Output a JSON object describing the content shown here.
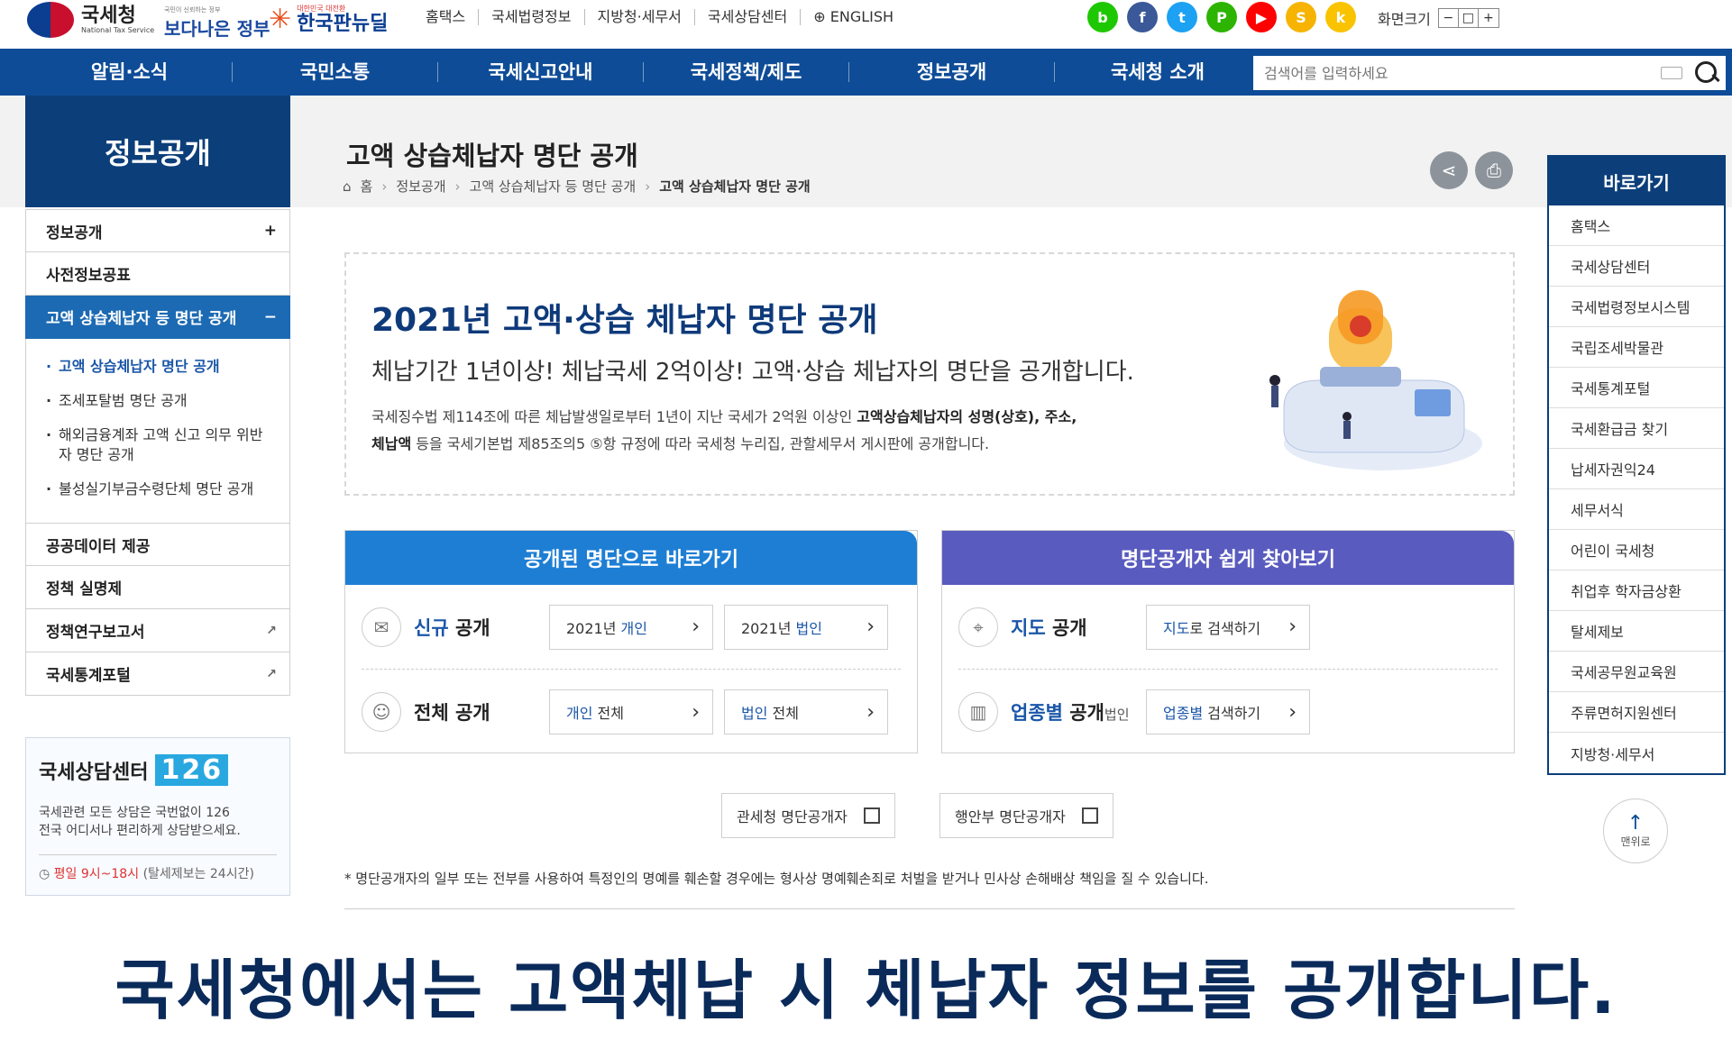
{
  "header": {
    "logo_text": "국세청",
    "logo_sub": "National Tax Service",
    "gov_tag": "국민이 신뢰하는 정부",
    "gov_slogan": "보다나은 정부",
    "newdeal_small": "대한민국 대전환",
    "newdeal_text": "한국판뉴딜",
    "links": [
      "홈택스",
      "국세법령정보",
      "지방청·세무서",
      "국세상담센터",
      "ENGLISH"
    ],
    "zoom_label": "화면크기",
    "zoom_controls": [
      "−",
      "□",
      "+"
    ],
    "sns": [
      {
        "name": "blog-icon",
        "color": "#1ec800",
        "glyph": "b"
      },
      {
        "name": "facebook-icon",
        "color": "#3b5998",
        "glyph": "f"
      },
      {
        "name": "twitter-icon",
        "color": "#1da1f2",
        "glyph": "t"
      },
      {
        "name": "naver-post-icon",
        "color": "#2db400",
        "glyph": "P"
      },
      {
        "name": "youtube-icon",
        "color": "#ff0000",
        "glyph": "▶"
      },
      {
        "name": "kakaostory-icon",
        "color": "#f6b400",
        "glyph": "S"
      },
      {
        "name": "kakao-icon",
        "color": "#f9c300",
        "glyph": "k"
      }
    ]
  },
  "gnb": {
    "items": [
      "알림·소식",
      "국민소통",
      "국세신고안내",
      "국세정책/제도",
      "정보공개",
      "국세청 소개"
    ],
    "search_placeholder": "검색어를 입력하세요"
  },
  "sidebar": {
    "title": "정보공개",
    "items_top": [
      {
        "label": "정보공개",
        "mark": "+"
      },
      {
        "label": "사전정보공표",
        "mark": ""
      },
      {
        "label": "고액 상습체납자 등 명단 공개",
        "mark": "−"
      }
    ],
    "sub_items": [
      "고액 상습체납자 명단 공개",
      "조세포탈범 명단 공개",
      "해외금융계좌 고액 신고 의무 위반자 명단 공개",
      "불성실기부금수령단체 명단 공개"
    ],
    "items_bottom": [
      {
        "label": "공공데이터 제공",
        "mark": ""
      },
      {
        "label": "정책 실명제",
        "mark": ""
      },
      {
        "label": "정책연구보고서",
        "mark": "↗"
      },
      {
        "label": "국세통계포털",
        "mark": "↗"
      }
    ],
    "call_center": {
      "title": "국세상담센터",
      "number": "126",
      "desc1": "국세관련 모든 상담은 국번없이 126",
      "desc2": "전국 어디서나 편리하게 상담받으세요.",
      "time_red": "평일 9시~18시",
      "time_rest": "(탈세제보는 24시간)"
    }
  },
  "main": {
    "title": "고액 상습체납자 명단 공개",
    "breadcrumb": [
      "홈",
      "정보공개",
      "고액 상습체납자 등 명단 공개",
      "고액 상습체납자 명단 공개"
    ],
    "hero": {
      "title": "2021년 고액·상습 체납자 명단 공개",
      "subtitle": "체납기간 1년이상! 체납국세 2억이상! 고액·상습 체납자의 명단을 공개합니다.",
      "desc_part1": "국세징수법 제114조에 따른 체납발생일로부터 1년이 지난 국세가 2억원 이상인 ",
      "desc_bold1": "고액상습체납자의 성명(상호), 주소,",
      "desc_bold2": "체납액",
      "desc_part2": " 등을 국세기본법 제85조의5 ⑤항 규정에 따라 국세청 누리집, 관할세무서 게시판에 공개합니다."
    },
    "card_left": {
      "header": "공개된 명단으로 바로가기",
      "color": "#1e7ed4",
      "row1": {
        "label_hl": "신규",
        "label": " 공개",
        "btn1_pre": "2021년 ",
        "btn1_hl": "개인",
        "btn2_pre": "2021년 ",
        "btn2_hl": "법인"
      },
      "row2": {
        "label": "전체 공개",
        "btn1_hl": "개인",
        "btn1_post": " 전체",
        "btn2_hl": "법인",
        "btn2_post": " 전체"
      }
    },
    "card_right": {
      "header": "명단공개자 쉽게 찾아보기",
      "color": "#5a5bbf",
      "row1": {
        "label_hl": "지도",
        "label": " 공개",
        "btn_hl": "지도",
        "btn_post": "로 검색하기"
      },
      "row2": {
        "label_hl": "업종별",
        "label": " 공개",
        "label_sm": "법인",
        "btn_hl": "업종별",
        "btn_post": " 검색하기"
      }
    },
    "ext_buttons": [
      "관세청 명단공개자",
      "행안부 명단공개자"
    ],
    "notice": "* 명단공개자의 일부 또는 전부를 사용하여 특정인의 명예를 훼손할 경우에는 형사상 명예훼손죄로 처벌을 받거나 민사상 손해배상 책임을 질 수 있습니다."
  },
  "quick": {
    "title": "바로가기",
    "items": [
      "홈택스",
      "국세상담센터",
      "국세법령정보시스템",
      "국립조세박물관",
      "국세통계포털",
      "국세환급금 찾기",
      "납세자권익24",
      "세무서식",
      "어린이 국세청",
      "취업후 학자금상환",
      "탈세제보",
      "국세공무원교육원",
      "주류면허지원센터",
      "지방청·세무서"
    ],
    "top_label": "맨위로"
  },
  "caption": "국세청에서는 고액체납 시 체납자 정보를 공개합니다."
}
